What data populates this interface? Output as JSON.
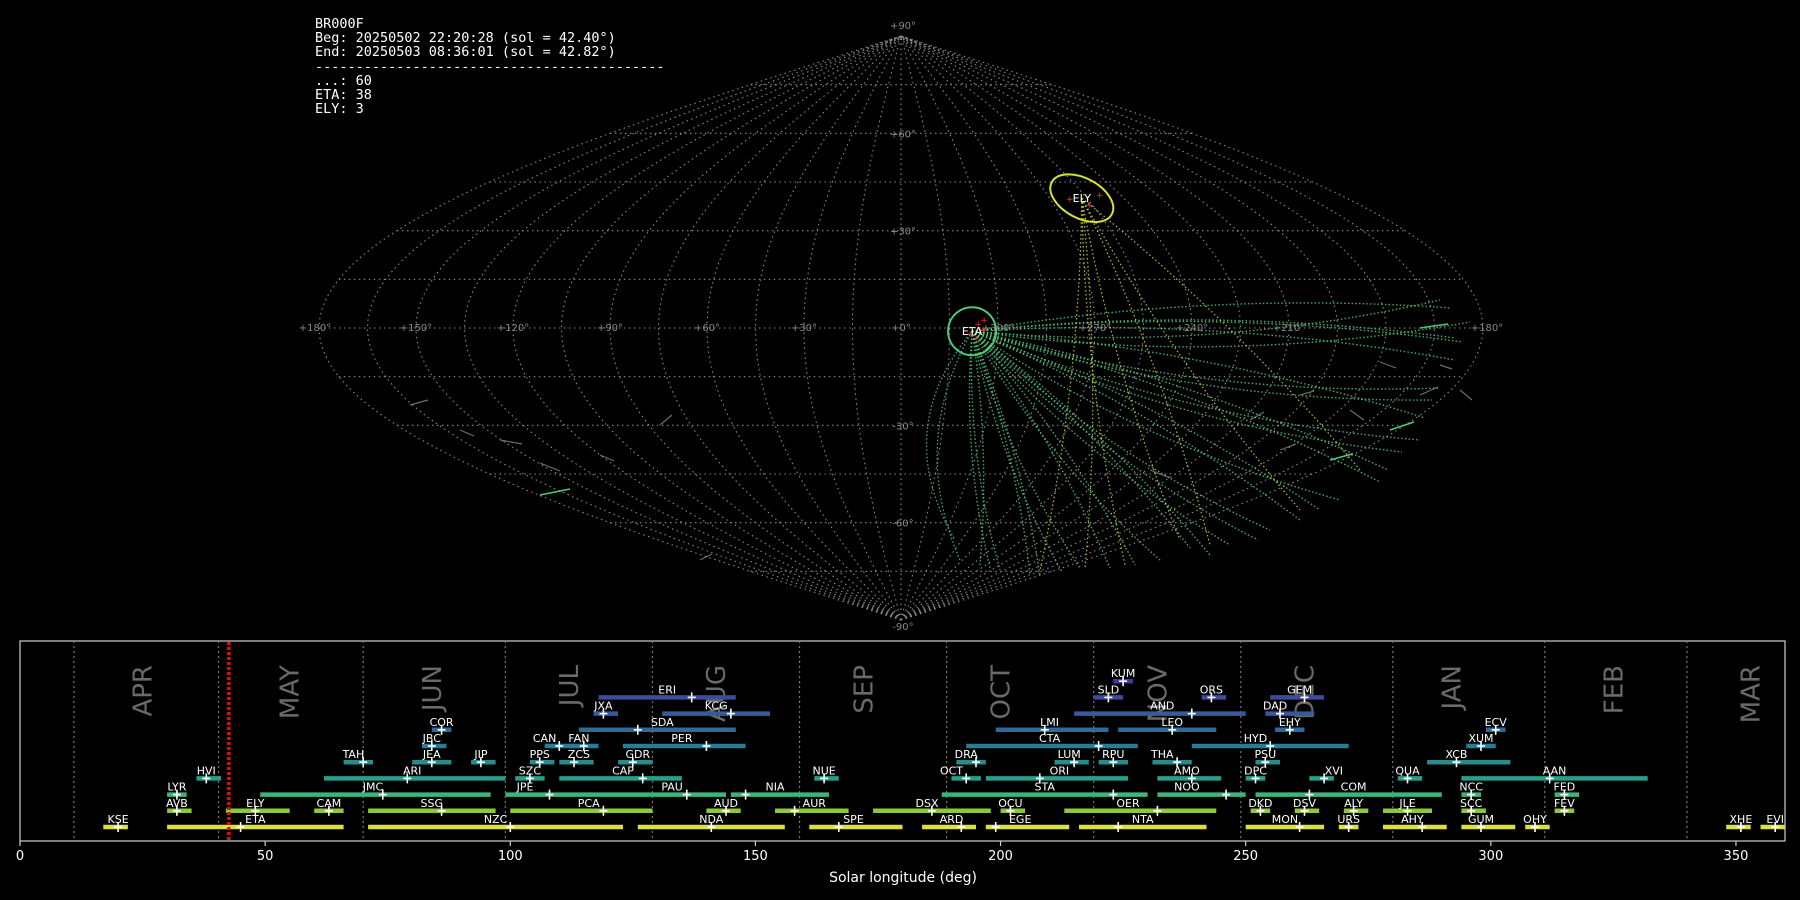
{
  "info": {
    "station": "BR000F",
    "begin": "Beg: 20250502 22:20:28 (sol = 42.40°)",
    "end": "End: 20250503 08:36:01 (sol = 42.82°)",
    "separator": "-------------------------------------------",
    "counts": [
      "...: 60",
      "ETA: 38",
      "ELY: 3"
    ]
  },
  "chart_data": [
    {
      "type": "scatter",
      "projection": "sinusoidal",
      "lon_labels": [
        "+180°",
        "+150°",
        "+120°",
        "+90°",
        "+60°",
        "+30°",
        "+0°",
        "+300°",
        "+270°",
        "+240°",
        "+210°",
        "+180°"
      ],
      "lat_labels": [
        "+90°",
        "+60°",
        "+30°",
        "-30°",
        "-60°",
        "-90°"
      ],
      "radiants": [
        {
          "name": "ETA",
          "lon": 338,
          "lat": -1,
          "color": "#4fc87a"
        },
        {
          "name": "ELY",
          "lon": 287,
          "lat": 40,
          "color": "#d8e03a"
        }
      ]
    },
    {
      "type": "timeline",
      "xlabel": "Solar longitude (deg)",
      "xlim": [
        0,
        360
      ],
      "xticks": [
        0,
        50,
        100,
        150,
        200,
        250,
        300,
        350
      ],
      "marker_sol": 42.6,
      "months": [
        {
          "name": "APR",
          "sol": 25,
          "boundary": 11
        },
        {
          "name": "MAY",
          "sol": 55,
          "boundary": 40.5
        },
        {
          "name": "JUN",
          "sol": 84,
          "boundary": 70
        },
        {
          "name": "JUL",
          "sol": 112,
          "boundary": 99
        },
        {
          "name": "AUG",
          "sol": 142,
          "boundary": 129
        },
        {
          "name": "SEP",
          "sol": 172,
          "boundary": 159
        },
        {
          "name": "OCT",
          "sol": 200,
          "boundary": 189
        },
        {
          "name": "NOV",
          "sol": 232,
          "boundary": 219
        },
        {
          "name": "DEC",
          "sol": 262,
          "boundary": 249
        },
        {
          "name": "JAN",
          "sol": 292,
          "boundary": 280
        },
        {
          "name": "FEB",
          "sol": 325,
          "boundary": 311
        },
        {
          "name": "MAR",
          "sol": 353,
          "boundary": 340
        }
      ],
      "showers": [
        {
          "name": "KUM",
          "row": 9,
          "start": 223,
          "end": 227,
          "peak": 225,
          "label_x": 225,
          "color": "#3d3d9c"
        },
        {
          "name": "ERI",
          "row": 8,
          "start": 118,
          "end": 146,
          "peak": 137,
          "label_x": 132,
          "color": "#3d4a9e"
        },
        {
          "name": "SLD",
          "row": 8,
          "start": 219,
          "end": 225,
          "peak": 222,
          "label_x": 222,
          "color": "#3d4a9e"
        },
        {
          "name": "ORS",
          "row": 8,
          "start": 241,
          "end": 246,
          "peak": 243,
          "label_x": 243,
          "color": "#3d4a9e"
        },
        {
          "name": "GEM",
          "row": 8,
          "start": 255,
          "end": 266,
          "peak": 262,
          "label_x": 261,
          "color": "#3d4a9e"
        },
        {
          "name": "JXA",
          "row": 7,
          "start": 117,
          "end": 122,
          "peak": 119,
          "label_x": 119,
          "color": "#39599a"
        },
        {
          "name": "KCG",
          "row": 7,
          "start": 131,
          "end": 153,
          "peak": 145,
          "label_x": 142,
          "color": "#39599a"
        },
        {
          "name": "AND",
          "row": 7,
          "start": 215,
          "end": 250,
          "peak": 239,
          "label_x": 233,
          "color": "#39599a"
        },
        {
          "name": "DAD",
          "row": 7,
          "start": 254,
          "end": 264,
          "peak": 257,
          "label_x": 256,
          "color": "#39599a"
        },
        {
          "name": "COR",
          "row": 6,
          "start": 84,
          "end": 88,
          "peak": 86,
          "label_x": 86,
          "color": "#32689a"
        },
        {
          "name": "SDA",
          "row": 6,
          "start": 114,
          "end": 146,
          "peak": 126,
          "label_x": 131,
          "color": "#32689a"
        },
        {
          "name": "LMI",
          "row": 6,
          "start": 199,
          "end": 222,
          "peak": 209,
          "label_x": 210,
          "color": "#32689a"
        },
        {
          "name": "LEO",
          "row": 6,
          "start": 224,
          "end": 244,
          "peak": 235,
          "label_x": 235,
          "color": "#32689a"
        },
        {
          "name": "EHY",
          "row": 6,
          "start": 256,
          "end": 262,
          "peak": 259,
          "label_x": 259,
          "color": "#32689a"
        },
        {
          "name": "ECV",
          "row": 6,
          "start": 299,
          "end": 303,
          "peak": 301,
          "label_x": 301,
          "color": "#32689a"
        },
        {
          "name": "JBC",
          "row": 5,
          "start": 82,
          "end": 87,
          "peak": 84,
          "label_x": 84,
          "color": "#2d7a94"
        },
        {
          "name": "CAN",
          "row": 5,
          "start": 107,
          "end": 113,
          "peak": 110,
          "label_x": 107,
          "color": "#2d7a94"
        },
        {
          "name": "FAN",
          "row": 5,
          "start": 112,
          "end": 118,
          "peak": 115,
          "label_x": 114,
          "color": "#2d7a94"
        },
        {
          "name": "PER",
          "row": 5,
          "start": 123,
          "end": 148,
          "peak": 140,
          "label_x": 135,
          "color": "#2d7a94"
        },
        {
          "name": "CTA",
          "row": 5,
          "start": 193,
          "end": 228,
          "peak": 220,
          "label_x": 210,
          "color": "#2d7a94"
        },
        {
          "name": "HYD",
          "row": 5,
          "start": 239,
          "end": 271,
          "peak": 255,
          "label_x": 252,
          "color": "#2d7a94"
        },
        {
          "name": "XUM",
          "row": 5,
          "start": 295,
          "end": 301,
          "peak": 298,
          "label_x": 298,
          "color": "#2d7a94"
        },
        {
          "name": "TAH",
          "row": 4,
          "start": 66,
          "end": 72,
          "peak": 70,
          "label_x": 68,
          "color": "#2a8a8c"
        },
        {
          "name": "JEA",
          "row": 4,
          "start": 80,
          "end": 88,
          "peak": 84,
          "label_x": 84,
          "color": "#2a8a8c"
        },
        {
          "name": "JIP",
          "row": 4,
          "start": 92,
          "end": 97,
          "peak": 94,
          "label_x": 94,
          "color": "#2a8a8c"
        },
        {
          "name": "PPS",
          "row": 4,
          "start": 104,
          "end": 109,
          "peak": 106,
          "label_x": 106,
          "color": "#2a8a8c"
        },
        {
          "name": "ZCS",
          "row": 4,
          "start": 110,
          "end": 117,
          "peak": 113,
          "label_x": 114,
          "color": "#2a8a8c"
        },
        {
          "name": "GDR",
          "row": 4,
          "start": 122,
          "end": 129,
          "peak": 125,
          "label_x": 126,
          "color": "#2a8a8c"
        },
        {
          "name": "DRA",
          "row": 4,
          "start": 191,
          "end": 197,
          "peak": 195,
          "label_x": 193,
          "color": "#2a8a8c"
        },
        {
          "name": "LUM",
          "row": 4,
          "start": 211,
          "end": 218,
          "peak": 215,
          "label_x": 214,
          "color": "#2a8a8c"
        },
        {
          "name": "RPU",
          "row": 4,
          "start": 220,
          "end": 226,
          "peak": 223,
          "label_x": 223,
          "color": "#2a8a8c"
        },
        {
          "name": "THA",
          "row": 4,
          "start": 231,
          "end": 239,
          "peak": 236,
          "label_x": 233,
          "color": "#2a8a8c"
        },
        {
          "name": "PSU",
          "row": 4,
          "start": 252,
          "end": 257,
          "peak": 254,
          "label_x": 254,
          "color": "#2a8a8c"
        },
        {
          "name": "XCB",
          "row": 4,
          "start": 287,
          "end": 304,
          "peak": 293,
          "label_x": 293,
          "color": "#2a8a8c"
        },
        {
          "name": "HVI",
          "row": 3,
          "start": 36,
          "end": 41,
          "peak": 38,
          "label_x": 38,
          "color": "#26a08a"
        },
        {
          "name": "ARI",
          "row": 3,
          "start": 62,
          "end": 99,
          "peak": 79,
          "label_x": 80,
          "color": "#26a08a"
        },
        {
          "name": "SZC",
          "row": 3,
          "start": 101,
          "end": 107,
          "peak": 104,
          "label_x": 104,
          "color": "#26a08a"
        },
        {
          "name": "CAP",
          "row": 3,
          "start": 110,
          "end": 135,
          "peak": 127,
          "label_x": 123,
          "color": "#26a08a"
        },
        {
          "name": "NUE",
          "row": 3,
          "start": 162,
          "end": 167,
          "peak": 164,
          "label_x": 164,
          "color": "#26a08a"
        },
        {
          "name": "OCT",
          "row": 3,
          "start": 190,
          "end": 196,
          "peak": 193,
          "label_x": 190,
          "color": "#26a08a"
        },
        {
          "name": "ORI",
          "row": 3,
          "start": 197,
          "end": 226,
          "peak": 208,
          "label_x": 212,
          "color": "#26a08a"
        },
        {
          "name": "AMO",
          "row": 3,
          "start": 232,
          "end": 245,
          "peak": 239,
          "label_x": 238,
          "color": "#26a08a"
        },
        {
          "name": "DPC",
          "row": 3,
          "start": 250,
          "end": 254,
          "peak": 252,
          "label_x": 252,
          "color": "#26a08a"
        },
        {
          "name": "XVI",
          "row": 3,
          "start": 263,
          "end": 268,
          "peak": 266,
          "label_x": 268,
          "color": "#26a08a"
        },
        {
          "name": "QUA",
          "row": 3,
          "start": 281,
          "end": 286,
          "peak": 283,
          "label_x": 283,
          "color": "#26a08a"
        },
        {
          "name": "AAN",
          "row": 3,
          "start": 294,
          "end": 332,
          "peak": 312,
          "label_x": 313,
          "color": "#26a08a"
        },
        {
          "name": "LYR",
          "row": 2,
          "start": 30,
          "end": 34,
          "peak": 32,
          "label_x": 32,
          "color": "#3db479"
        },
        {
          "name": "JMC",
          "row": 2,
          "start": 49,
          "end": 96,
          "peak": 74,
          "label_x": 72,
          "color": "#3db479"
        },
        {
          "name": "JPE",
          "row": 2,
          "start": 99,
          "end": 123,
          "peak": 108,
          "label_x": 103,
          "color": "#3db479"
        },
        {
          "name": "PAU",
          "row": 2,
          "start": 123,
          "end": 144,
          "peak": 136,
          "label_x": 133,
          "color": "#3db479"
        },
        {
          "name": "NIA",
          "row": 2,
          "start": 145,
          "end": 165,
          "peak": 148,
          "label_x": 154,
          "color": "#3db479"
        },
        {
          "name": "STA",
          "row": 2,
          "start": 188,
          "end": 230,
          "peak": 223,
          "label_x": 209,
          "color": "#3db479"
        },
        {
          "name": "NOO",
          "row": 2,
          "start": 232,
          "end": 250,
          "peak": 246,
          "label_x": 238,
          "color": "#3db479"
        },
        {
          "name": "COM",
          "row": 2,
          "start": 252,
          "end": 290,
          "peak": 263,
          "label_x": 272,
          "color": "#3db479"
        },
        {
          "name": "NCC",
          "row": 2,
          "start": 294,
          "end": 298,
          "peak": 296,
          "label_x": 296,
          "color": "#3db479"
        },
        {
          "name": "FED",
          "row": 2,
          "start": 313,
          "end": 318,
          "peak": 315,
          "label_x": 315,
          "color": "#3db479"
        },
        {
          "name": "AVB",
          "row": 1,
          "start": 30,
          "end": 35,
          "peak": 32,
          "label_x": 32,
          "color": "#8cc83c"
        },
        {
          "name": "ELY",
          "row": 1,
          "start": 42,
          "end": 55,
          "peak": 48,
          "label_x": 48,
          "color": "#8cc83c"
        },
        {
          "name": "CAM",
          "row": 1,
          "start": 60,
          "end": 66,
          "peak": 63,
          "label_x": 63,
          "color": "#8cc83c"
        },
        {
          "name": "SSG",
          "row": 1,
          "start": 71,
          "end": 97,
          "peak": 86,
          "label_x": 84,
          "color": "#8cc83c"
        },
        {
          "name": "PCA",
          "row": 1,
          "start": 100,
          "end": 129,
          "peak": 119,
          "label_x": 116,
          "color": "#8cc83c"
        },
        {
          "name": "AUD",
          "row": 1,
          "start": 140,
          "end": 147,
          "peak": 144,
          "label_x": 144,
          "color": "#8cc83c"
        },
        {
          "name": "AUR",
          "row": 1,
          "start": 154,
          "end": 169,
          "peak": 158,
          "label_x": 162,
          "color": "#8cc83c"
        },
        {
          "name": "DSX",
          "row": 1,
          "start": 174,
          "end": 198,
          "peak": 186,
          "label_x": 185,
          "color": "#8cc83c"
        },
        {
          "name": "OCU",
          "row": 1,
          "start": 200,
          "end": 205,
          "peak": 202,
          "label_x": 202,
          "color": "#8cc83c"
        },
        {
          "name": "OER",
          "row": 1,
          "start": 213,
          "end": 244,
          "peak": 232,
          "label_x": 226,
          "color": "#8cc83c"
        },
        {
          "name": "DKD",
          "row": 1,
          "start": 251,
          "end": 255,
          "peak": 253,
          "label_x": 253,
          "color": "#8cc83c"
        },
        {
          "name": "DSV",
          "row": 1,
          "start": 260,
          "end": 265,
          "peak": 262,
          "label_x": 262,
          "color": "#8cc83c"
        },
        {
          "name": "ALY",
          "row": 1,
          "start": 270,
          "end": 275,
          "peak": 272,
          "label_x": 272,
          "color": "#8cc83c"
        },
        {
          "name": "JLE",
          "row": 1,
          "start": 278,
          "end": 288,
          "peak": 283,
          "label_x": 283,
          "color": "#8cc83c"
        },
        {
          "name": "SCC",
          "row": 1,
          "start": 294,
          "end": 299,
          "peak": 296,
          "label_x": 296,
          "color": "#8cc83c"
        },
        {
          "name": "FEV",
          "row": 1,
          "start": 313,
          "end": 317,
          "peak": 315,
          "label_x": 315,
          "color": "#8cc83c"
        },
        {
          "name": "KSE",
          "row": 0,
          "start": 17,
          "end": 22,
          "peak": 20,
          "label_x": 20,
          "color": "#dbe03a"
        },
        {
          "name": "ETA",
          "row": 0,
          "start": 30,
          "end": 66,
          "peak": 45,
          "label_x": 48,
          "color": "#dbe03a"
        },
        {
          "name": "NZC",
          "row": 0,
          "start": 71,
          "end": 123,
          "peak": 100,
          "label_x": 97,
          "color": "#dbe03a"
        },
        {
          "name": "NDA",
          "row": 0,
          "start": 126,
          "end": 156,
          "peak": 141,
          "label_x": 141,
          "color": "#dbe03a"
        },
        {
          "name": "SPE",
          "row": 0,
          "start": 161,
          "end": 180,
          "peak": 167,
          "label_x": 170,
          "color": "#dbe03a"
        },
        {
          "name": "ARD",
          "row": 0,
          "start": 184,
          "end": 195,
          "peak": 192,
          "label_x": 190,
          "color": "#dbe03a"
        },
        {
          "name": "EGE",
          "row": 0,
          "start": 197,
          "end": 214,
          "peak": 199,
          "label_x": 204,
          "color": "#dbe03a"
        },
        {
          "name": "NTA",
          "row": 0,
          "start": 216,
          "end": 242,
          "peak": 224,
          "label_x": 229,
          "color": "#dbe03a"
        },
        {
          "name": "MON",
          "row": 0,
          "start": 250,
          "end": 266,
          "peak": 261,
          "label_x": 258,
          "color": "#dbe03a"
        },
        {
          "name": "URS",
          "row": 0,
          "start": 269,
          "end": 273,
          "peak": 271,
          "label_x": 271,
          "color": "#dbe03a"
        },
        {
          "name": "AHY",
          "row": 0,
          "start": 278,
          "end": 291,
          "peak": 286,
          "label_x": 284,
          "color": "#dbe03a"
        },
        {
          "name": "GUM",
          "row": 0,
          "start": 294,
          "end": 305,
          "peak": 298,
          "label_x": 298,
          "color": "#dbe03a"
        },
        {
          "name": "OHY",
          "row": 0,
          "start": 307,
          "end": 312,
          "peak": 309,
          "label_x": 309,
          "color": "#dbe03a"
        },
        {
          "name": "XHE",
          "row": 0,
          "start": 348,
          "end": 353,
          "peak": 351,
          "label_x": 351,
          "color": "#dbe03a"
        },
        {
          "name": "EVI",
          "row": 0,
          "start": 355,
          "end": 360,
          "peak": 358,
          "label_x": 358,
          "color": "#dbe03a"
        }
      ]
    }
  ]
}
